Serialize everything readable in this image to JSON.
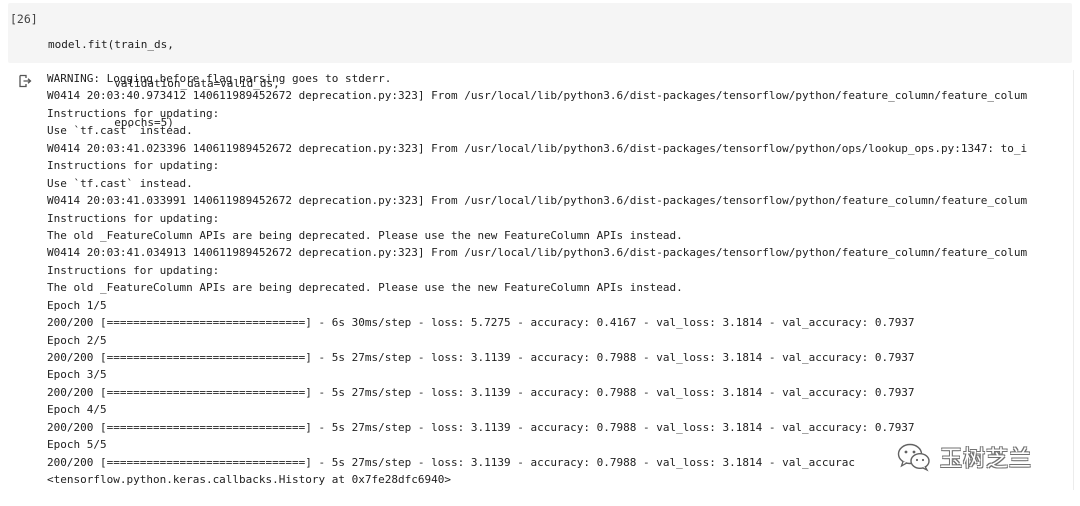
{
  "cell": {
    "execution_count": "[26]",
    "code_lines": [
      "model.fit(train_ds,",
      "          validation_data=valid_ds,",
      "          epochs=5)"
    ]
  },
  "output": {
    "icon": "output-redirect-icon",
    "lines": [
      "WARNING: Logging before flag parsing goes to stderr.",
      "W0414 20:03:40.973412 140611989452672 deprecation.py:323] From /usr/local/lib/python3.6/dist-packages/tensorflow/python/feature_column/feature_colum",
      "Instructions for updating:",
      "Use `tf.cast` instead.",
      "W0414 20:03:41.023396 140611989452672 deprecation.py:323] From /usr/local/lib/python3.6/dist-packages/tensorflow/python/ops/lookup_ops.py:1347: to_i",
      "Instructions for updating:",
      "Use `tf.cast` instead.",
      "W0414 20:03:41.033991 140611989452672 deprecation.py:323] From /usr/local/lib/python3.6/dist-packages/tensorflow/python/feature_column/feature_colum",
      "Instructions for updating:",
      "The old _FeatureColumn APIs are being deprecated. Please use the new FeatureColumn APIs instead.",
      "W0414 20:03:41.034913 140611989452672 deprecation.py:323] From /usr/local/lib/python3.6/dist-packages/tensorflow/python/feature_column/feature_colum",
      "Instructions for updating:",
      "The old _FeatureColumn APIs are being deprecated. Please use the new FeatureColumn APIs instead.",
      "Epoch 1/5",
      "200/200 [==============================] - 6s 30ms/step - loss: 5.7275 - accuracy: 0.4167 - val_loss: 3.1814 - val_accuracy: 0.7937",
      "Epoch 2/5",
      "200/200 [==============================] - 5s 27ms/step - loss: 3.1139 - accuracy: 0.7988 - val_loss: 3.1814 - val_accuracy: 0.7937",
      "Epoch 3/5",
      "200/200 [==============================] - 5s 27ms/step - loss: 3.1139 - accuracy: 0.7988 - val_loss: 3.1814 - val_accuracy: 0.7937",
      "Epoch 4/5",
      "200/200 [==============================] - 5s 27ms/step - loss: 3.1139 - accuracy: 0.7988 - val_loss: 3.1814 - val_accuracy: 0.7937",
      "Epoch 5/5",
      "200/200 [==============================] - 5s 27ms/step - loss: 3.1139 - accuracy: 0.7988 - val_loss: 3.1814 - val_accurac",
      "<tensorflow.python.keras.callbacks.History at 0x7fe28dfc6940>"
    ]
  },
  "watermark": {
    "text": "玉树芝兰",
    "icon": "wechat-logo-icon"
  }
}
